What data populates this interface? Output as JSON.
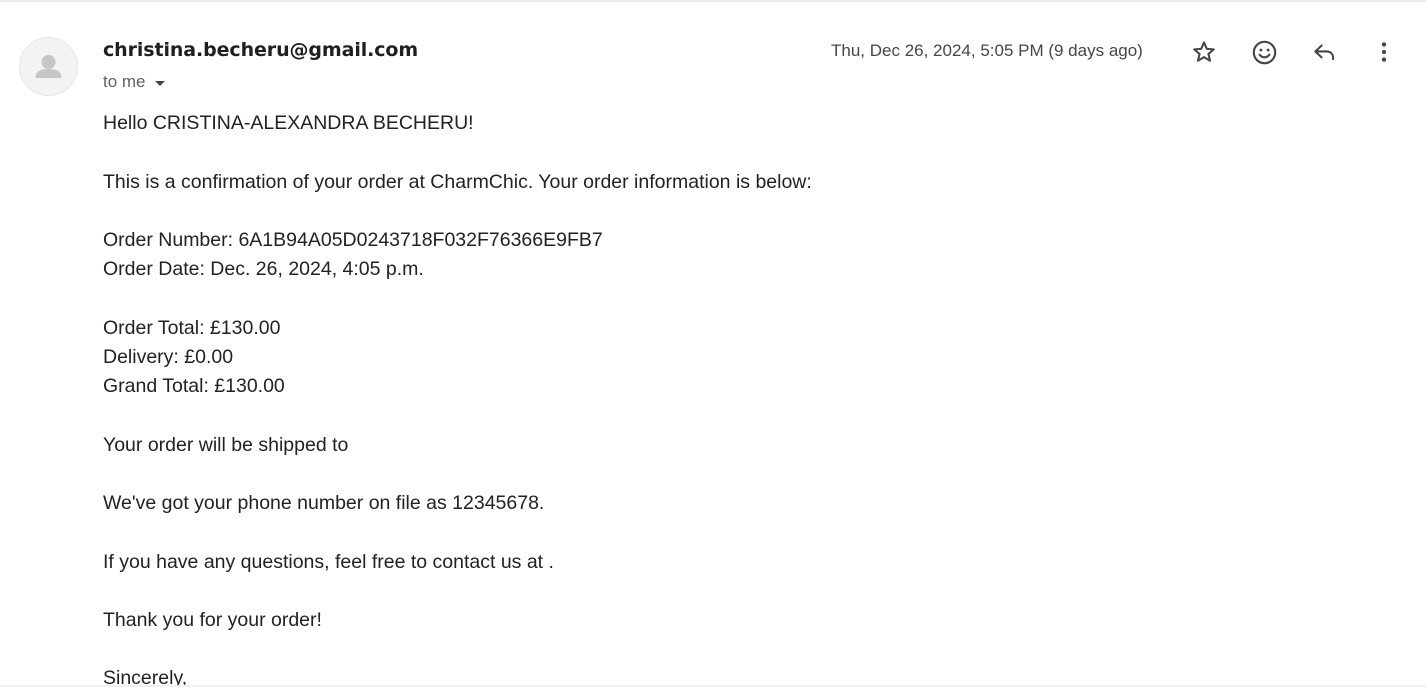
{
  "header": {
    "sender": "christina.becheru@gmail.com",
    "recipient": "to me",
    "timestamp": "Thu, Dec 26, 2024, 5:05 PM (9 days ago)"
  },
  "icons": {
    "avatar": "person-icon",
    "star": "star-icon",
    "emoji": "emoji-icon",
    "reply": "reply-icon",
    "more": "more-vert-icon",
    "caret": "caret-down-icon"
  },
  "message": {
    "greeting": "Hello CRISTINA-ALEXANDRA BECHERU!",
    "intro": "This is a confirmation of your order at CharmChic. Your order information is below:",
    "order_number": "Order Number: 6A1B94A05D0243718F032F76366E9FB7",
    "order_date": "Order Date: Dec. 26, 2024, 4:05 p.m.",
    "order_total": "Order Total: £130.00",
    "delivery": "Delivery: £0.00",
    "grand_total": "Grand Total: £130.00",
    "shipping": "Your order will be shipped to",
    "phone": "We've got your phone number on file as 12345678.",
    "questions": "If you have any questions, feel free to contact us at .",
    "thanks": "Thank you for your order!",
    "signoff": "Sincerely,"
  }
}
